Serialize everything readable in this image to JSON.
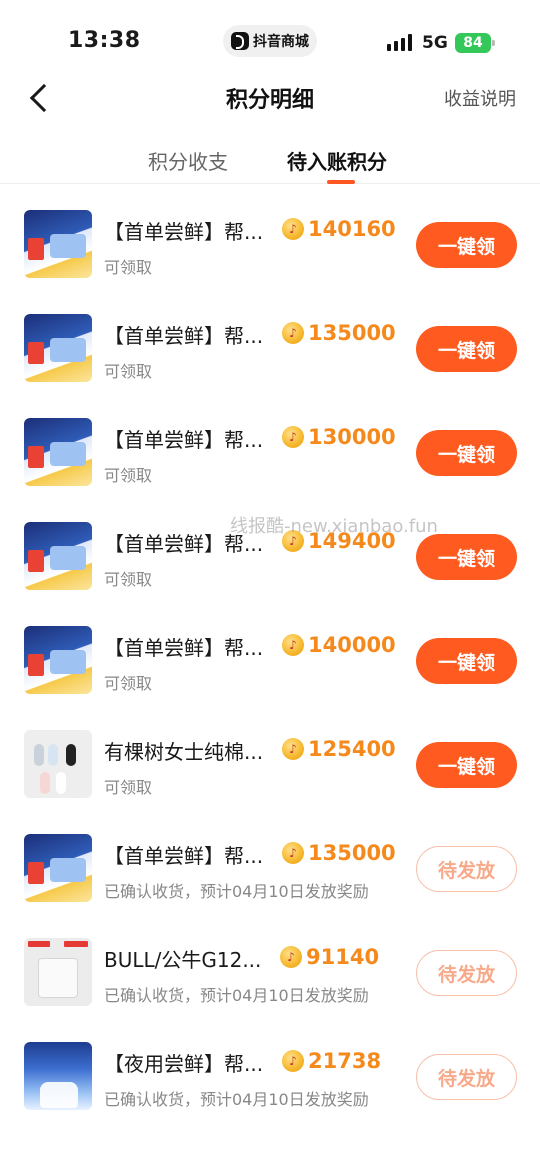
{
  "status_bar": {
    "time": "13:38",
    "app_pill": "抖音商城",
    "network": "5G",
    "battery": "84"
  },
  "nav": {
    "title": "积分明细",
    "right": "收益说明"
  },
  "tabs": {
    "items": [
      "积分收支",
      "待入账积分"
    ],
    "active": "待入账积分"
  },
  "watermark": "线报酷-new.xianbao.fun",
  "colors": {
    "accent": "#ff5a1f",
    "points": "#f4891c",
    "pending_text": "#f7a98a"
  },
  "rows": [
    {
      "title": "【首单尝鲜】帮...",
      "points": "140160",
      "sub": "可领取",
      "button": "一键领",
      "state": "claim",
      "thumb": "drink"
    },
    {
      "title": "【首单尝鲜】帮...",
      "points": "135000",
      "sub": "可领取",
      "button": "一键领",
      "state": "claim",
      "thumb": "drink"
    },
    {
      "title": "【首单尝鲜】帮...",
      "points": "130000",
      "sub": "可领取",
      "button": "一键领",
      "state": "claim",
      "thumb": "drink"
    },
    {
      "title": "【首单尝鲜】帮...",
      "points": "149400",
      "sub": "可领取",
      "button": "一键领",
      "state": "claim",
      "thumb": "drink"
    },
    {
      "title": "【首单尝鲜】帮...",
      "points": "140000",
      "sub": "可领取",
      "button": "一键领",
      "state": "claim",
      "thumb": "drink"
    },
    {
      "title": "有棵树女士纯棉...",
      "points": "125400",
      "sub": "可领取",
      "button": "一键领",
      "state": "claim",
      "thumb": "socks"
    },
    {
      "title": "【首单尝鲜】帮...",
      "points": "135000",
      "sub": "已确认收货，预计04月10日发放奖励",
      "button": "待发放",
      "state": "pending",
      "thumb": "drink"
    },
    {
      "title": "BULL/公牛G12...",
      "points": "91140",
      "sub": "已确认收货，预计04月10日发放奖励",
      "button": "待发放",
      "state": "pending",
      "thumb": "plug"
    },
    {
      "title": "【夜用尝鲜】帮...",
      "points": "21738",
      "sub": "已确认收货，预计04月10日发放奖励",
      "button": "待发放",
      "state": "pending",
      "thumb": "night"
    }
  ]
}
